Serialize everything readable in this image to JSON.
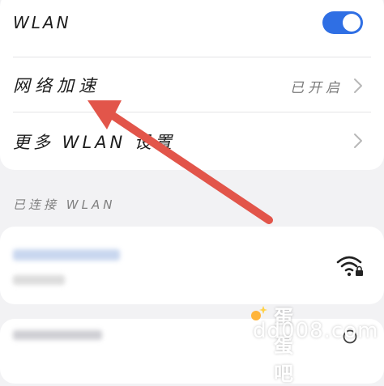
{
  "wlan": {
    "label": "WLAN",
    "enabled": true
  },
  "network_accel": {
    "label": "网络加速",
    "value": "已开启"
  },
  "more_wlan": {
    "label": "更多 WLAN 设置"
  },
  "connected_section": {
    "title": "已连接 WLAN"
  },
  "watermark": {
    "title": "蛋蛋吧",
    "url": "dd008.com"
  },
  "colors": {
    "accent": "#2f6fe4",
    "arrow": "#e2554a"
  }
}
